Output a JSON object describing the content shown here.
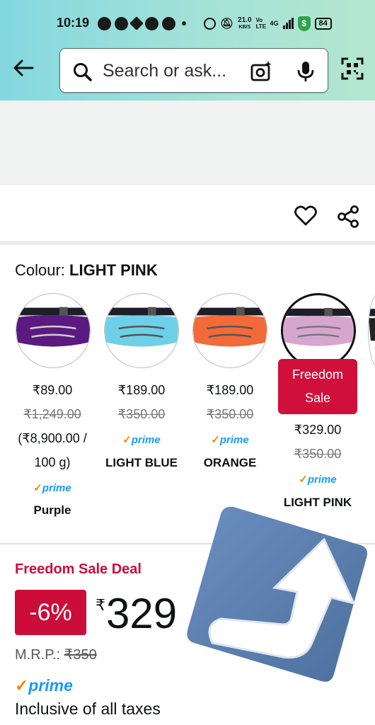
{
  "status_bar": {
    "time": "10:19",
    "speed": "21.0",
    "speed_unit": "KB/S",
    "network": "4G",
    "volte": "Vo LTE",
    "battery": "84"
  },
  "search": {
    "placeholder": "Search or ask..."
  },
  "colour": {
    "label": "Colour: ",
    "selected": "LIGHT PINK"
  },
  "variants": [
    {
      "price": "₹89.00",
      "mrp": "₹1,249.00",
      "unit_price_line1": "(₹8,900.00 /",
      "unit_price_line2": "100 g)",
      "prime": "prime",
      "name": "Purple",
      "color": "#5b1a80"
    },
    {
      "price": "₹189.00",
      "mrp": "₹350.00",
      "prime": "prime",
      "name": "LIGHT BLUE",
      "color": "#6ed0e8"
    },
    {
      "price": "₹189.00",
      "mrp": "₹350.00",
      "prime": "prime",
      "name": "ORANGE",
      "color": "#f26a3a"
    },
    {
      "badge_line1": "Freedom",
      "badge_line2": "Sale",
      "price": "₹329.00",
      "mrp": "₹350.00",
      "prime": "prime",
      "name": "LIGHT PINK",
      "color": "#d7a6d0"
    }
  ],
  "deal": {
    "title": "Freedom Sale Deal",
    "discount": "-6%",
    "currency": "₹",
    "price": "329",
    "mrp_label": "M.R.P.: ",
    "mrp_value": "₹350",
    "prime": "prime",
    "taxes": "Inclusive of all taxes"
  },
  "colors": {
    "deal_red": "#cc0c39",
    "badge_red": "#d0103a",
    "prime_blue": "#1a98ff",
    "prime_orange": "#f08804"
  }
}
